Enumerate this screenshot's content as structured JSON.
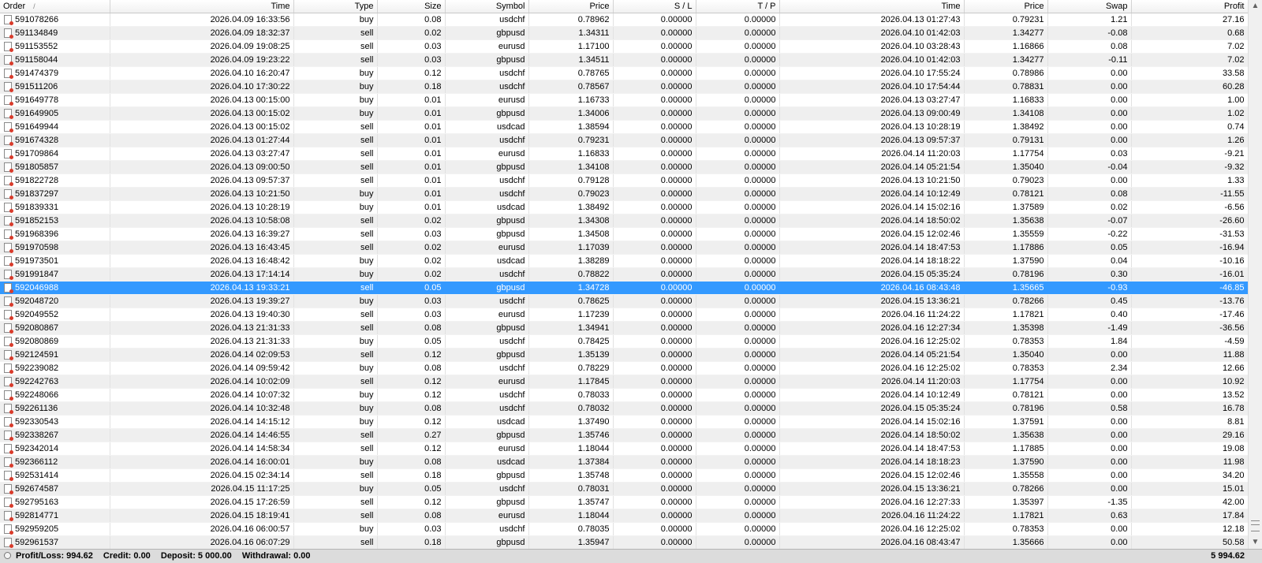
{
  "columns": [
    {
      "label": "Order",
      "sort": "/",
      "align": "left"
    },
    {
      "label": "Time",
      "align": "right"
    },
    {
      "label": "Type",
      "align": "right"
    },
    {
      "label": "Size",
      "align": "right"
    },
    {
      "label": "Symbol",
      "align": "right"
    },
    {
      "label": "Price",
      "align": "right"
    },
    {
      "label": "S / L",
      "align": "right"
    },
    {
      "label": "T / P",
      "align": "right"
    },
    {
      "label": "Time",
      "align": "right"
    },
    {
      "label": "Price",
      "align": "right"
    },
    {
      "label": "Swap",
      "align": "right"
    },
    {
      "label": "Profit",
      "align": "right"
    }
  ],
  "selected_order": "592046988",
  "rows": [
    [
      "591078266",
      "2026.04.09 16:33:56",
      "buy",
      "0.08",
      "usdchf",
      "0.78962",
      "0.00000",
      "0.00000",
      "2026.04.13 01:27:43",
      "0.79231",
      "1.21",
      "27.16"
    ],
    [
      "591134849",
      "2026.04.09 18:32:37",
      "sell",
      "0.02",
      "gbpusd",
      "1.34311",
      "0.00000",
      "0.00000",
      "2026.04.10 01:42:03",
      "1.34277",
      "-0.08",
      "0.68"
    ],
    [
      "591153552",
      "2026.04.09 19:08:25",
      "sell",
      "0.03",
      "eurusd",
      "1.17100",
      "0.00000",
      "0.00000",
      "2026.04.10 03:28:43",
      "1.16866",
      "0.08",
      "7.02"
    ],
    [
      "591158044",
      "2026.04.09 19:23:22",
      "sell",
      "0.03",
      "gbpusd",
      "1.34511",
      "0.00000",
      "0.00000",
      "2026.04.10 01:42:03",
      "1.34277",
      "-0.11",
      "7.02"
    ],
    [
      "591474379",
      "2026.04.10 16:20:47",
      "buy",
      "0.12",
      "usdchf",
      "0.78765",
      "0.00000",
      "0.00000",
      "2026.04.10 17:55:24",
      "0.78986",
      "0.00",
      "33.58"
    ],
    [
      "591511206",
      "2026.04.10 17:30:22",
      "buy",
      "0.18",
      "usdchf",
      "0.78567",
      "0.00000",
      "0.00000",
      "2026.04.10 17:54:44",
      "0.78831",
      "0.00",
      "60.28"
    ],
    [
      "591649778",
      "2026.04.13 00:15:00",
      "buy",
      "0.01",
      "eurusd",
      "1.16733",
      "0.00000",
      "0.00000",
      "2026.04.13 03:27:47",
      "1.16833",
      "0.00",
      "1.00"
    ],
    [
      "591649905",
      "2026.04.13 00:15:02",
      "buy",
      "0.01",
      "gbpusd",
      "1.34006",
      "0.00000",
      "0.00000",
      "2026.04.13 09:00:49",
      "1.34108",
      "0.00",
      "1.02"
    ],
    [
      "591649944",
      "2026.04.13 00:15:02",
      "sell",
      "0.01",
      "usdcad",
      "1.38594",
      "0.00000",
      "0.00000",
      "2026.04.13 10:28:19",
      "1.38492",
      "0.00",
      "0.74"
    ],
    [
      "591674328",
      "2026.04.13 01:27:44",
      "sell",
      "0.01",
      "usdchf",
      "0.79231",
      "0.00000",
      "0.00000",
      "2026.04.13 09:57:37",
      "0.79131",
      "0.00",
      "1.26"
    ],
    [
      "591709864",
      "2026.04.13 03:27:47",
      "sell",
      "0.01",
      "eurusd",
      "1.16833",
      "0.00000",
      "0.00000",
      "2026.04.14 11:20:03",
      "1.17754",
      "0.03",
      "-9.21"
    ],
    [
      "591805857",
      "2026.04.13 09:00:50",
      "sell",
      "0.01",
      "gbpusd",
      "1.34108",
      "0.00000",
      "0.00000",
      "2026.04.14 05:21:54",
      "1.35040",
      "-0.04",
      "-9.32"
    ],
    [
      "591822728",
      "2026.04.13 09:57:37",
      "sell",
      "0.01",
      "usdchf",
      "0.79128",
      "0.00000",
      "0.00000",
      "2026.04.13 10:21:50",
      "0.79023",
      "0.00",
      "1.33"
    ],
    [
      "591837297",
      "2026.04.13 10:21:50",
      "buy",
      "0.01",
      "usdchf",
      "0.79023",
      "0.00000",
      "0.00000",
      "2026.04.14 10:12:49",
      "0.78121",
      "0.08",
      "-11.55"
    ],
    [
      "591839331",
      "2026.04.13 10:28:19",
      "buy",
      "0.01",
      "usdcad",
      "1.38492",
      "0.00000",
      "0.00000",
      "2026.04.14 15:02:16",
      "1.37589",
      "0.02",
      "-6.56"
    ],
    [
      "591852153",
      "2026.04.13 10:58:08",
      "sell",
      "0.02",
      "gbpusd",
      "1.34308",
      "0.00000",
      "0.00000",
      "2026.04.14 18:50:02",
      "1.35638",
      "-0.07",
      "-26.60"
    ],
    [
      "591968396",
      "2026.04.13 16:39:27",
      "sell",
      "0.03",
      "gbpusd",
      "1.34508",
      "0.00000",
      "0.00000",
      "2026.04.15 12:02:46",
      "1.35559",
      "-0.22",
      "-31.53"
    ],
    [
      "591970598",
      "2026.04.13 16:43:45",
      "sell",
      "0.02",
      "eurusd",
      "1.17039",
      "0.00000",
      "0.00000",
      "2026.04.14 18:47:53",
      "1.17886",
      "0.05",
      "-16.94"
    ],
    [
      "591973501",
      "2026.04.13 16:48:42",
      "buy",
      "0.02",
      "usdcad",
      "1.38289",
      "0.00000",
      "0.00000",
      "2026.04.14 18:18:22",
      "1.37590",
      "0.04",
      "-10.16"
    ],
    [
      "591991847",
      "2026.04.13 17:14:14",
      "buy",
      "0.02",
      "usdchf",
      "0.78822",
      "0.00000",
      "0.00000",
      "2026.04.15 05:35:24",
      "0.78196",
      "0.30",
      "-16.01"
    ],
    [
      "592046988",
      "2026.04.13 19:33:21",
      "sell",
      "0.05",
      "gbpusd",
      "1.34728",
      "0.00000",
      "0.00000",
      "2026.04.16 08:43:48",
      "1.35665",
      "-0.93",
      "-46.85"
    ],
    [
      "592048720",
      "2026.04.13 19:39:27",
      "buy",
      "0.03",
      "usdchf",
      "0.78625",
      "0.00000",
      "0.00000",
      "2026.04.15 13:36:21",
      "0.78266",
      "0.45",
      "-13.76"
    ],
    [
      "592049552",
      "2026.04.13 19:40:30",
      "sell",
      "0.03",
      "eurusd",
      "1.17239",
      "0.00000",
      "0.00000",
      "2026.04.16 11:24:22",
      "1.17821",
      "0.40",
      "-17.46"
    ],
    [
      "592080867",
      "2026.04.13 21:31:33",
      "sell",
      "0.08",
      "gbpusd",
      "1.34941",
      "0.00000",
      "0.00000",
      "2026.04.16 12:27:34",
      "1.35398",
      "-1.49",
      "-36.56"
    ],
    [
      "592080869",
      "2026.04.13 21:31:33",
      "buy",
      "0.05",
      "usdchf",
      "0.78425",
      "0.00000",
      "0.00000",
      "2026.04.16 12:25:02",
      "0.78353",
      "1.84",
      "-4.59"
    ],
    [
      "592124591",
      "2026.04.14 02:09:53",
      "sell",
      "0.12",
      "gbpusd",
      "1.35139",
      "0.00000",
      "0.00000",
      "2026.04.14 05:21:54",
      "1.35040",
      "0.00",
      "11.88"
    ],
    [
      "592239082",
      "2026.04.14 09:59:42",
      "buy",
      "0.08",
      "usdchf",
      "0.78229",
      "0.00000",
      "0.00000",
      "2026.04.16 12:25:02",
      "0.78353",
      "2.34",
      "12.66"
    ],
    [
      "592242763",
      "2026.04.14 10:02:09",
      "sell",
      "0.12",
      "eurusd",
      "1.17845",
      "0.00000",
      "0.00000",
      "2026.04.14 11:20:03",
      "1.17754",
      "0.00",
      "10.92"
    ],
    [
      "592248066",
      "2026.04.14 10:07:32",
      "buy",
      "0.12",
      "usdchf",
      "0.78033",
      "0.00000",
      "0.00000",
      "2026.04.14 10:12:49",
      "0.78121",
      "0.00",
      "13.52"
    ],
    [
      "592261136",
      "2026.04.14 10:32:48",
      "buy",
      "0.08",
      "usdchf",
      "0.78032",
      "0.00000",
      "0.00000",
      "2026.04.15 05:35:24",
      "0.78196",
      "0.58",
      "16.78"
    ],
    [
      "592330543",
      "2026.04.14 14:15:12",
      "buy",
      "0.12",
      "usdcad",
      "1.37490",
      "0.00000",
      "0.00000",
      "2026.04.14 15:02:16",
      "1.37591",
      "0.00",
      "8.81"
    ],
    [
      "592338267",
      "2026.04.14 14:46:55",
      "sell",
      "0.27",
      "gbpusd",
      "1.35746",
      "0.00000",
      "0.00000",
      "2026.04.14 18:50:02",
      "1.35638",
      "0.00",
      "29.16"
    ],
    [
      "592342014",
      "2026.04.14 14:58:34",
      "sell",
      "0.12",
      "eurusd",
      "1.18044",
      "0.00000",
      "0.00000",
      "2026.04.14 18:47:53",
      "1.17885",
      "0.00",
      "19.08"
    ],
    [
      "592366112",
      "2026.04.14 16:00:01",
      "buy",
      "0.08",
      "usdcad",
      "1.37384",
      "0.00000",
      "0.00000",
      "2026.04.14 18:18:23",
      "1.37590",
      "0.00",
      "11.98"
    ],
    [
      "592531414",
      "2026.04.15 02:34:14",
      "sell",
      "0.18",
      "gbpusd",
      "1.35748",
      "0.00000",
      "0.00000",
      "2026.04.15 12:02:46",
      "1.35558",
      "0.00",
      "34.20"
    ],
    [
      "592674587",
      "2026.04.15 11:17:25",
      "buy",
      "0.05",
      "usdchf",
      "0.78031",
      "0.00000",
      "0.00000",
      "2026.04.15 13:36:21",
      "0.78266",
      "0.00",
      "15.01"
    ],
    [
      "592795163",
      "2026.04.15 17:26:59",
      "sell",
      "0.12",
      "gbpusd",
      "1.35747",
      "0.00000",
      "0.00000",
      "2026.04.16 12:27:33",
      "1.35397",
      "-1.35",
      "42.00"
    ],
    [
      "592814771",
      "2026.04.15 18:19:41",
      "sell",
      "0.08",
      "eurusd",
      "1.18044",
      "0.00000",
      "0.00000",
      "2026.04.16 11:24:22",
      "1.17821",
      "0.63",
      "17.84"
    ],
    [
      "592959205",
      "2026.04.16 06:00:57",
      "buy",
      "0.03",
      "usdchf",
      "0.78035",
      "0.00000",
      "0.00000",
      "2026.04.16 12:25:02",
      "0.78353",
      "0.00",
      "12.18"
    ],
    [
      "592961537",
      "2026.04.16 06:07:29",
      "sell",
      "0.18",
      "gbpusd",
      "1.35947",
      "0.00000",
      "0.00000",
      "2026.04.16 08:43:47",
      "1.35666",
      "0.00",
      "50.58"
    ]
  ],
  "status_bar": {
    "profit_loss": "Profit/Loss: 994.62",
    "credit": "Credit: 0.00",
    "deposit": "Deposit: 5 000.00",
    "withdrawal": "Withdrawal: 0.00",
    "balance": "5 994.62"
  },
  "icons": {
    "row_icon": "closed-order-icon",
    "scroll_up": "▲",
    "scroll_down": "▼"
  },
  "colors": {
    "selection": "#3399ff",
    "row_alt": "#efefef",
    "status_bar": "#dcdcdc"
  }
}
